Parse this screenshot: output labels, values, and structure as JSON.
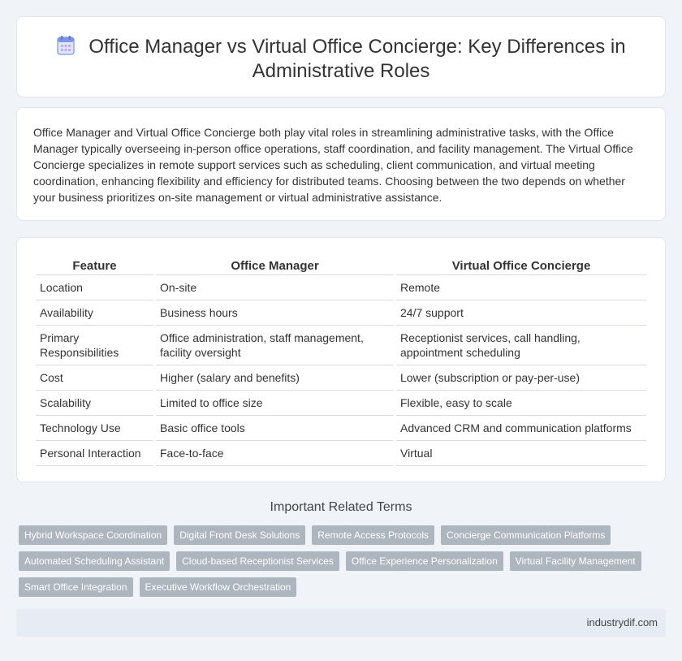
{
  "header": {
    "title": "Office Manager vs Virtual Office Concierge: Key Differences in Administrative Roles",
    "icon": "calendar-icon",
    "accent": "#5b7bd5"
  },
  "intro": {
    "text": "Office Manager and Virtual Office Concierge both play vital roles in streamlining administrative tasks, with the Office Manager typically overseeing in-person office operations, staff coordination, and facility management. The Virtual Office Concierge specializes in remote support services such as scheduling, client communication, and virtual meeting coordination, enhancing flexibility and efficiency for distributed teams. Choosing between the two depends on whether your business prioritizes on-site management or virtual administrative assistance."
  },
  "table": {
    "headers": [
      "Feature",
      "Office Manager",
      "Virtual Office Concierge"
    ],
    "rows": [
      [
        "Location",
        "On-site",
        "Remote"
      ],
      [
        "Availability",
        "Business hours",
        "24/7 support"
      ],
      [
        "Primary Responsibilities",
        "Office administration, staff management, facility oversight",
        "Receptionist services, call handling, appointment scheduling"
      ],
      [
        "Cost",
        "Higher (salary and benefits)",
        "Lower (subscription or pay-per-use)"
      ],
      [
        "Scalability",
        "Limited to office size",
        "Flexible, easy to scale"
      ],
      [
        "Technology Use",
        "Basic office tools",
        "Advanced CRM and communication platforms"
      ],
      [
        "Personal Interaction",
        "Face-to-face",
        "Virtual"
      ]
    ]
  },
  "related": {
    "heading": "Important Related Terms",
    "tags": [
      "Hybrid Workspace Coordination",
      "Digital Front Desk Solutions",
      "Remote Access Protocols",
      "Concierge Communication Platforms",
      "Automated Scheduling Assistant",
      "Cloud-based Receptionist Services",
      "Office Experience Personalization",
      "Virtual Facility Management",
      "Smart Office Integration",
      "Executive Workflow Orchestration"
    ]
  },
  "footer": {
    "site": "industrydif.com"
  }
}
